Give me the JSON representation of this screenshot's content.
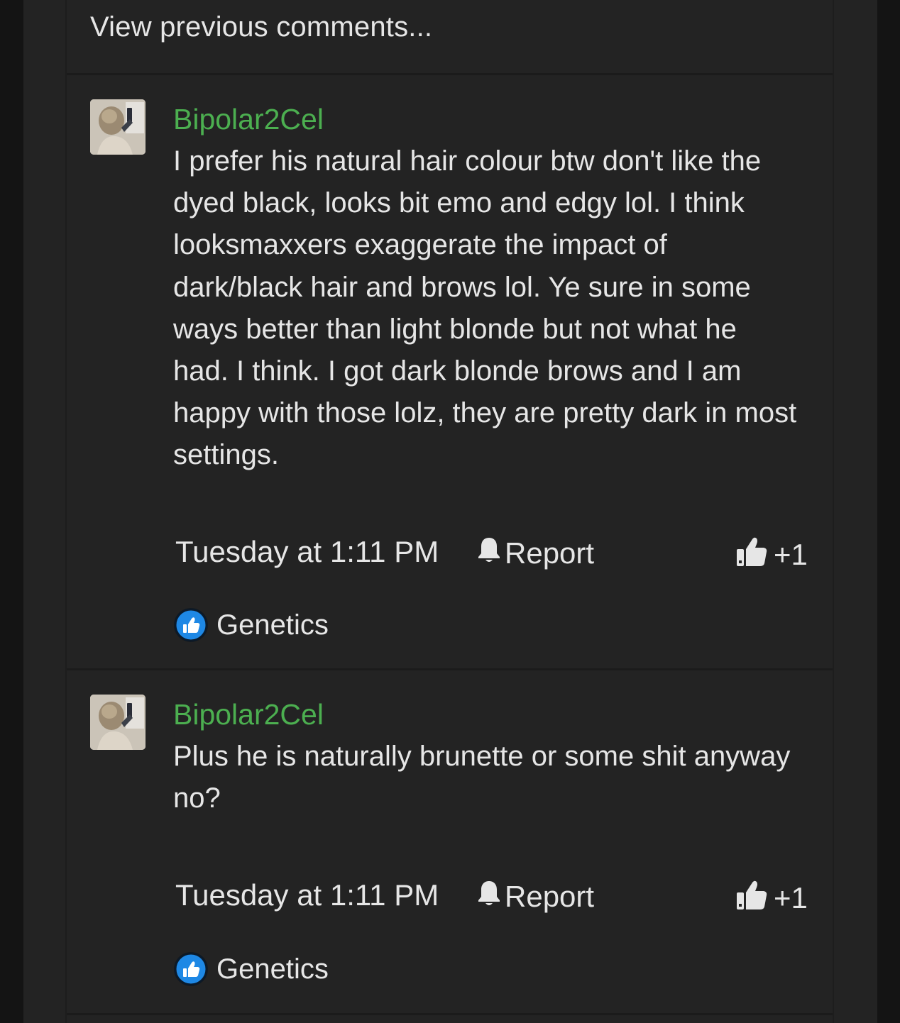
{
  "view_previous": "View previous comments...",
  "comments": [
    {
      "username": "Bipolar2Cel",
      "text": "I prefer his natural hair colour btw don't like the dyed black, looks bit emo and edgy lol. I think looksmaxxers exaggerate the impact of dark/black hair and brows lol. Ye sure in some ways better than light blonde but not what he had. I think. I got dark blonde brows and I am happy with those lolz, they are pretty dark in most settings.",
      "timestamp": "Tuesday at 1:11 PM",
      "report_label": "Report",
      "like_label": "+1",
      "reaction_label": "Genetics"
    },
    {
      "username": "Bipolar2Cel",
      "text": "Plus he is naturally brunette or some shit anyway no?",
      "timestamp": "Tuesday at 1:11 PM",
      "report_label": "Report",
      "like_label": "+1",
      "reaction_label": "Genetics"
    }
  ],
  "colors": {
    "username": "#4caf50",
    "text": "#e6e6e6",
    "background": "#232323",
    "reaction_blue": "#1e88e5"
  }
}
